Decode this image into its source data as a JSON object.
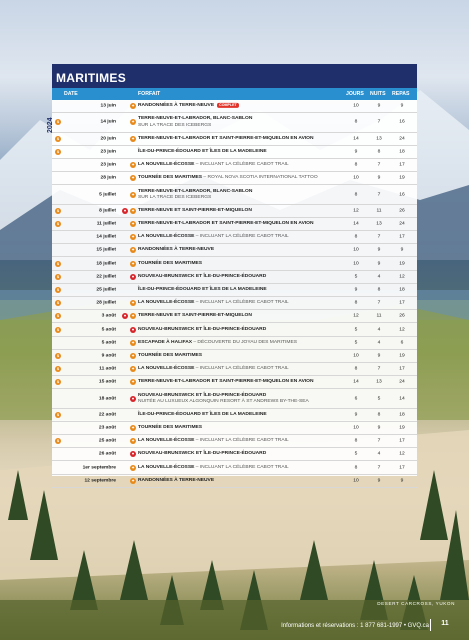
{
  "section_title": "MARITIMES",
  "year": "2024",
  "columns": {
    "date": "DATE",
    "package": "FORFAIT",
    "days": "JOURS",
    "nights": "NUITS",
    "meals": "REPAS"
  },
  "rows": [
    {
      "date": "13 juin",
      "marker": "",
      "icon": "orange",
      "title": "RANDONNÉES À TERRE-NEUVE",
      "sub": "",
      "badge": "COMPLET",
      "days": "10",
      "nights": "9",
      "meals": "9"
    },
    {
      "date": "14 juin",
      "marker": "orange",
      "icon": "orange",
      "title": "TERRE-NEUVE-ET-LABRADOR, BLANC-SABLON",
      "sub": "SUR LA TRACE DES ICEBERGS",
      "badge": "",
      "days": "8",
      "nights": "7",
      "meals": "16"
    },
    {
      "date": "20 juin",
      "marker": "orange",
      "icon": "orange",
      "title": "TERRE-NEUVE-ET-LABRADOR ET SAINT-PIERRE-ET-MIQUELON EN AVION",
      "sub": "",
      "badge": "",
      "days": "14",
      "nights": "13",
      "meals": "24"
    },
    {
      "date": "23 juin",
      "marker": "orange",
      "icon": "",
      "title": "ÎLE-DU-PRINCE-ÉDOUARD ET ÎLES DE LA MADELEINE",
      "sub": "",
      "badge": "",
      "days": "9",
      "nights": "8",
      "meals": "18"
    },
    {
      "date": "23 juin",
      "marker": "",
      "icon": "orange",
      "title": "LA NOUVELLE-ÉCOSSE",
      "sub": " – INCLUANT LA CÉLÈBRE CABOT TRAIL",
      "badge": "",
      "days": "8",
      "nights": "7",
      "meals": "17"
    },
    {
      "date": "28 juin",
      "marker": "",
      "icon": "orange",
      "title": "TOURNÉE DES MARITIMES",
      "sub": " – ROYAL NOVA SCOTIA INTERNATIONAL TATTOO",
      "badge": "",
      "days": "10",
      "nights": "9",
      "meals": "19"
    },
    {
      "date": "5 juillet",
      "marker": "",
      "icon": "orange",
      "title": "TERRE-NEUVE-ET-LABRADOR, BLANC-SABLON",
      "sub": "SUR LA TRACE DES ICEBERGS",
      "badge": "",
      "days": "8",
      "nights": "7",
      "meals": "16"
    },
    {
      "date": "8 juillet",
      "marker": "orange",
      "icon": "orange",
      "icon2": "heart",
      "title": "TERRE-NEUVE ET SAINT-PIERRE-ET-MIQUELON",
      "sub": "",
      "badge": "",
      "days": "12",
      "nights": "11",
      "meals": "26"
    },
    {
      "date": "11 juillet",
      "marker": "orange",
      "icon": "orange",
      "title": "TERRE-NEUVE-ET-LABRADOR ET SAINT-PIERRE-ET-MIQUELON EN AVION",
      "sub": "",
      "badge": "",
      "days": "14",
      "nights": "13",
      "meals": "24"
    },
    {
      "date": "14 juillet",
      "marker": "",
      "icon": "orange",
      "title": "LA NOUVELLE-ÉCOSSE",
      "sub": " – INCLUANT LA CÉLÈBRE CABOT TRAIL",
      "badge": "",
      "days": "8",
      "nights": "7",
      "meals": "17"
    },
    {
      "date": "15 juillet",
      "marker": "",
      "icon": "orange",
      "title": "RANDONNÉES À TERRE-NEUVE",
      "sub": "",
      "badge": "",
      "days": "10",
      "nights": "9",
      "meals": "9"
    },
    {
      "date": "18 juillet",
      "marker": "orange",
      "icon": "orange",
      "title": "TOURNÉE DES MARITIMES",
      "sub": "",
      "badge": "",
      "days": "10",
      "nights": "9",
      "meals": "19"
    },
    {
      "date": "22 juillet",
      "marker": "orange",
      "icon": "heart",
      "title": "NOUVEAU-BRUNSWICK ET ÎLE-DU-PRINCE-ÉDOUARD",
      "sub": "",
      "badge": "",
      "days": "5",
      "nights": "4",
      "meals": "12"
    },
    {
      "date": "25 juillet",
      "marker": "orange",
      "icon": "",
      "title": "ÎLE-DU-PRINCE-ÉDOUARD ET ÎLES DE LA MADELEINE",
      "sub": "",
      "badge": "",
      "days": "9",
      "nights": "8",
      "meals": "18"
    },
    {
      "date": "28 juillet",
      "marker": "orange",
      "icon": "orange",
      "title": "LA NOUVELLE-ÉCOSSE",
      "sub": " – INCLUANT LA CÉLÈBRE CABOT TRAIL",
      "badge": "",
      "days": "8",
      "nights": "7",
      "meals": "17"
    },
    {
      "date": "3 août",
      "marker": "orange",
      "icon": "orange",
      "icon2": "heart",
      "title": "TERRE-NEUVE ET SAINT-PIERRE-ET-MIQUELON",
      "sub": "",
      "badge": "",
      "days": "12",
      "nights": "11",
      "meals": "26"
    },
    {
      "date": "5 août",
      "marker": "orange",
      "icon": "heart",
      "title": "NOUVEAU-BRUNSWICK ET ÎLE-DU-PRINCE-ÉDOUARD",
      "sub": "",
      "badge": "",
      "days": "5",
      "nights": "4",
      "meals": "12"
    },
    {
      "date": "5 août",
      "marker": "",
      "icon": "orange",
      "title": "ESCAPADE À HALIFAX",
      "sub": " – DÉCOUVERTE DU JOYAU DES MARITIMES",
      "badge": "",
      "days": "5",
      "nights": "4",
      "meals": "6"
    },
    {
      "date": "9 août",
      "marker": "orange",
      "icon": "orange",
      "title": "TOURNÉE DES MARITIMES",
      "sub": "",
      "badge": "",
      "days": "10",
      "nights": "9",
      "meals": "19"
    },
    {
      "date": "11 août",
      "marker": "orange",
      "icon": "orange",
      "title": "LA NOUVELLE-ÉCOSSE",
      "sub": " – INCLUANT LA CÉLÈBRE CABOT TRAIL",
      "badge": "",
      "days": "8",
      "nights": "7",
      "meals": "17"
    },
    {
      "date": "15 août",
      "marker": "orange",
      "icon": "orange",
      "title": "TERRE-NEUVE-ET-LABRADOR ET SAINT-PIERRE-ET-MIQUELON EN AVION",
      "sub": "",
      "badge": "",
      "days": "14",
      "nights": "13",
      "meals": "24"
    },
    {
      "date": "18 août",
      "marker": "",
      "icon": "heart",
      "title": "NOUVEAU-BRUNSWICK ET ÎLE-DU-PRINCE-ÉDOUARD",
      "sub": "NUITÉE AU LUXUEUX ALGONQUIN RESORT À ST ANDREWS BY-THE-SEA",
      "badge": "",
      "days": "6",
      "nights": "5",
      "meals": "14"
    },
    {
      "date": "22 août",
      "marker": "orange",
      "icon": "",
      "title": "ÎLE-DU-PRINCE-ÉDOUARD ET ÎLES DE LA MADELEINE",
      "sub": "",
      "badge": "",
      "days": "9",
      "nights": "8",
      "meals": "18"
    },
    {
      "date": "23 août",
      "marker": "",
      "icon": "orange",
      "title": "TOURNÉE DES MARITIMES",
      "sub": "",
      "badge": "",
      "days": "10",
      "nights": "9",
      "meals": "19"
    },
    {
      "date": "25 août",
      "marker": "orange",
      "icon": "orange",
      "title": "LA NOUVELLE-ÉCOSSE",
      "sub": " – INCLUANT LA CÉLÈBRE CABOT TRAIL",
      "badge": "",
      "days": "8",
      "nights": "7",
      "meals": "17"
    },
    {
      "date": "26 août",
      "marker": "",
      "icon": "heart",
      "title": "NOUVEAU-BRUNSWICK ET ÎLE-DU-PRINCE-ÉDOUARD",
      "sub": "",
      "badge": "",
      "days": "5",
      "nights": "4",
      "meals": "12"
    },
    {
      "date": "1er septembre",
      "marker": "",
      "icon": "orange",
      "title": "LA NOUVELLE-ÉCOSSE",
      "sub": " – INCLUANT LA CÉLÈBRE CABOT TRAIL",
      "badge": "",
      "days": "8",
      "nights": "7",
      "meals": "17"
    },
    {
      "date": "12 septembre",
      "marker": "",
      "icon": "orange",
      "title": "RANDONNÉES À TERRE-NEUVE",
      "sub": "",
      "badge": "",
      "days": "10",
      "nights": "9",
      "meals": "9"
    }
  ],
  "photo_caption": "DESERT CARCROSS, YUKON",
  "footer_text": "Informations et réservations : 1 877 681-1997 • GVQ.ca",
  "page_number": "11",
  "colors": {
    "title_bg": "#1f2f6b",
    "header_bg": "#2a8fce",
    "marker_orange": "#e88a1a",
    "marker_red": "#d7252b"
  }
}
